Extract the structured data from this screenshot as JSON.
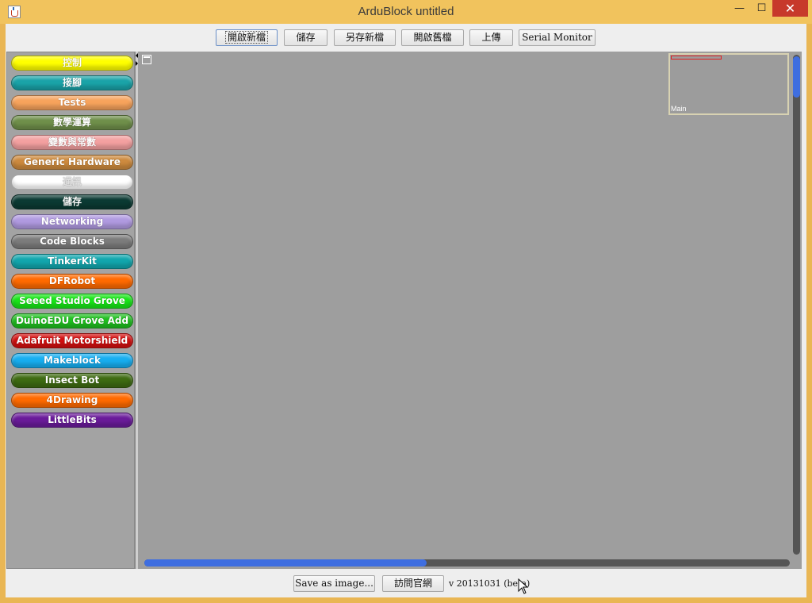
{
  "window": {
    "title": "ArduBlock untitled",
    "controls": {
      "minimize": "—",
      "maximize": "☐",
      "close": "✕"
    }
  },
  "toolbar": {
    "buttons": [
      {
        "label": "開啟新檔",
        "focused": true
      },
      {
        "label": "儲存"
      },
      {
        "label": "另存新檔"
      },
      {
        "label": "開啟舊檔"
      },
      {
        "label": "上傳"
      },
      {
        "label": "Serial Monitor"
      }
    ]
  },
  "palette": {
    "categories": [
      {
        "label": "控制",
        "color": "#ffff00",
        "text_color": "#ffffff"
      },
      {
        "label": "接腳",
        "color": "#1aa3a8",
        "text_color": "#ffffff"
      },
      {
        "label": "Tests",
        "color": "#f7a35c",
        "text_color": "#ffffff"
      },
      {
        "label": "數學運算",
        "color": "#6f8f4a",
        "text_color": "#ffffff"
      },
      {
        "label": "變數與常數",
        "color": "#f3a0a0",
        "text_color": "#ffffff"
      },
      {
        "label": "Generic Hardware",
        "color": "#cd8a3e",
        "text_color": "#ffffff"
      },
      {
        "label": "通訊",
        "color": "#ffffff",
        "text_color": "#e0e0e0"
      },
      {
        "label": "儲存",
        "color": "#0b3a33",
        "text_color": "#ffffff"
      },
      {
        "label": "Networking",
        "color": "#b09ae0",
        "text_color": "#ffffff"
      },
      {
        "label": "Code Blocks",
        "color": "#7c7c7c",
        "text_color": "#ffffff"
      },
      {
        "label": "TinkerKit",
        "color": "#12a6ad",
        "text_color": "#ffffff"
      },
      {
        "label": "DFRobot",
        "color": "#ff6a00",
        "text_color": "#ffffff"
      },
      {
        "label": "Seeed Studio Grove",
        "color": "#18e618",
        "text_color": "#ffffff"
      },
      {
        "label": "DuinoEDU Grove Add",
        "color": "#1fbf1f",
        "text_color": "#ffffff"
      },
      {
        "label": "Adafruit Motorshield",
        "color": "#d30f0f",
        "text_color": "#ffffff"
      },
      {
        "label": "Makeblock",
        "color": "#17aef0",
        "text_color": "#ffffff"
      },
      {
        "label": "Insect Bot",
        "color": "#3e6b12",
        "text_color": "#ffffff"
      },
      {
        "label": "4Drawing",
        "color": "#ff6a00",
        "text_color": "#ffffff"
      },
      {
        "label": "LittleBits",
        "color": "#6a1b9a",
        "text_color": "#ffffff"
      }
    ]
  },
  "canvas": {
    "minimap_label": "Main"
  },
  "bottombar": {
    "save_image_label": "Save as image...",
    "visit_site_label": "訪問官網",
    "version": "v 20131031 (beta)"
  }
}
